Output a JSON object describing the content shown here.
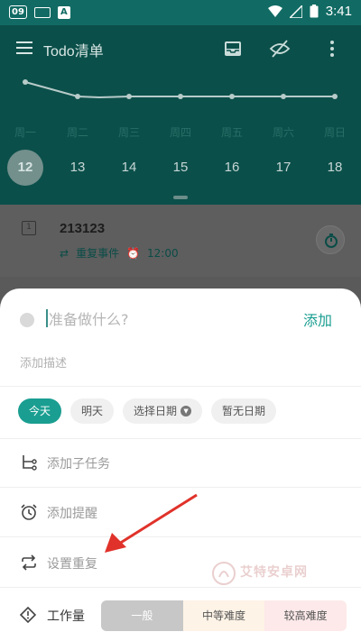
{
  "status_bar": {
    "badge": "09",
    "time": "3:41"
  },
  "header": {
    "title": "Todo清单"
  },
  "week": {
    "days": [
      "周一",
      "周二",
      "周三",
      "周四",
      "周五",
      "周六",
      "周日"
    ],
    "dates": [
      "12",
      "13",
      "14",
      "15",
      "16",
      "17",
      "18"
    ],
    "selected_index": 0
  },
  "task": {
    "title": "213123",
    "repeat_label": "重复事件",
    "time": "12:00"
  },
  "sheet": {
    "input_placeholder": "准备做什么?",
    "add_label": "添加",
    "description_placeholder": "添加描述",
    "date_chips": [
      "今天",
      "明天",
      "选择日期",
      "暂无日期"
    ],
    "subtask_label": "添加子任务",
    "reminder_label": "添加提醒",
    "repeat_label": "设置重复",
    "workload_label": "工作量",
    "workload_options": [
      "一般",
      "中等难度",
      "较高难度"
    ]
  },
  "watermark": {
    "text": "艾特安卓网"
  },
  "colors": {
    "primary": "#1a9e91",
    "header_dim": "#0b4f4a",
    "arrow": "#e0322a"
  }
}
